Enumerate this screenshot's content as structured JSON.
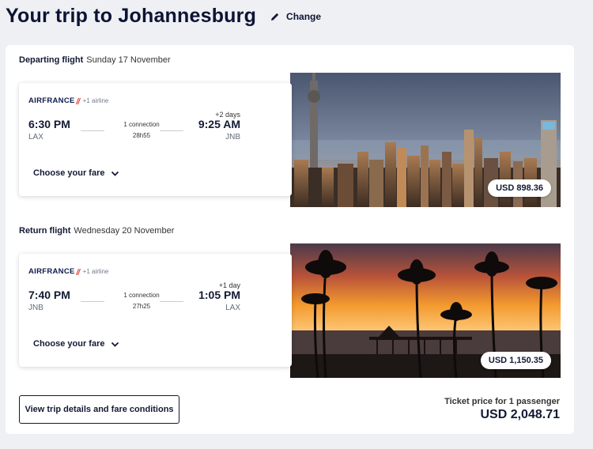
{
  "header": {
    "title": "Your trip to Johannesburg",
    "change_label": "Change"
  },
  "outbound": {
    "heading_label": "Departing flight",
    "heading_date": "Sunday 17 November",
    "airline": "AIRFRANCE",
    "extra_airline": "+1 airline",
    "dep_time": "6:30 PM",
    "dep_code": "LAX",
    "arr_time": "9:25 AM",
    "arr_code": "JNB",
    "plus_days": "+2 days",
    "connections": "1 connection",
    "duration": "28h55",
    "choose_fare": "Choose your fare",
    "price": "USD 898.36"
  },
  "inbound": {
    "heading_label": "Return flight",
    "heading_date": "Wednesday 20 November",
    "airline": "AIRFRANCE",
    "extra_airline": "+1 airline",
    "dep_time": "7:40 PM",
    "dep_code": "JNB",
    "arr_time": "1:05 PM",
    "arr_code": "LAX",
    "plus_days": "+1 day",
    "connections": "1 connection",
    "duration": "27h25",
    "choose_fare": "Choose your fare",
    "price": "USD 1,150.35"
  },
  "footer": {
    "details_button": "View trip details and fare conditions",
    "ticket_label": "Ticket price for 1 passenger",
    "total_price": "USD 2,048.71"
  },
  "icons": {
    "change": "pencil-icon",
    "chevron": "chevron-down-icon",
    "airline_mark": "air-france-slash-icon"
  },
  "colors": {
    "brand_red": "#e2231a",
    "navy": "#0e1a4d",
    "text": "#121a33"
  }
}
